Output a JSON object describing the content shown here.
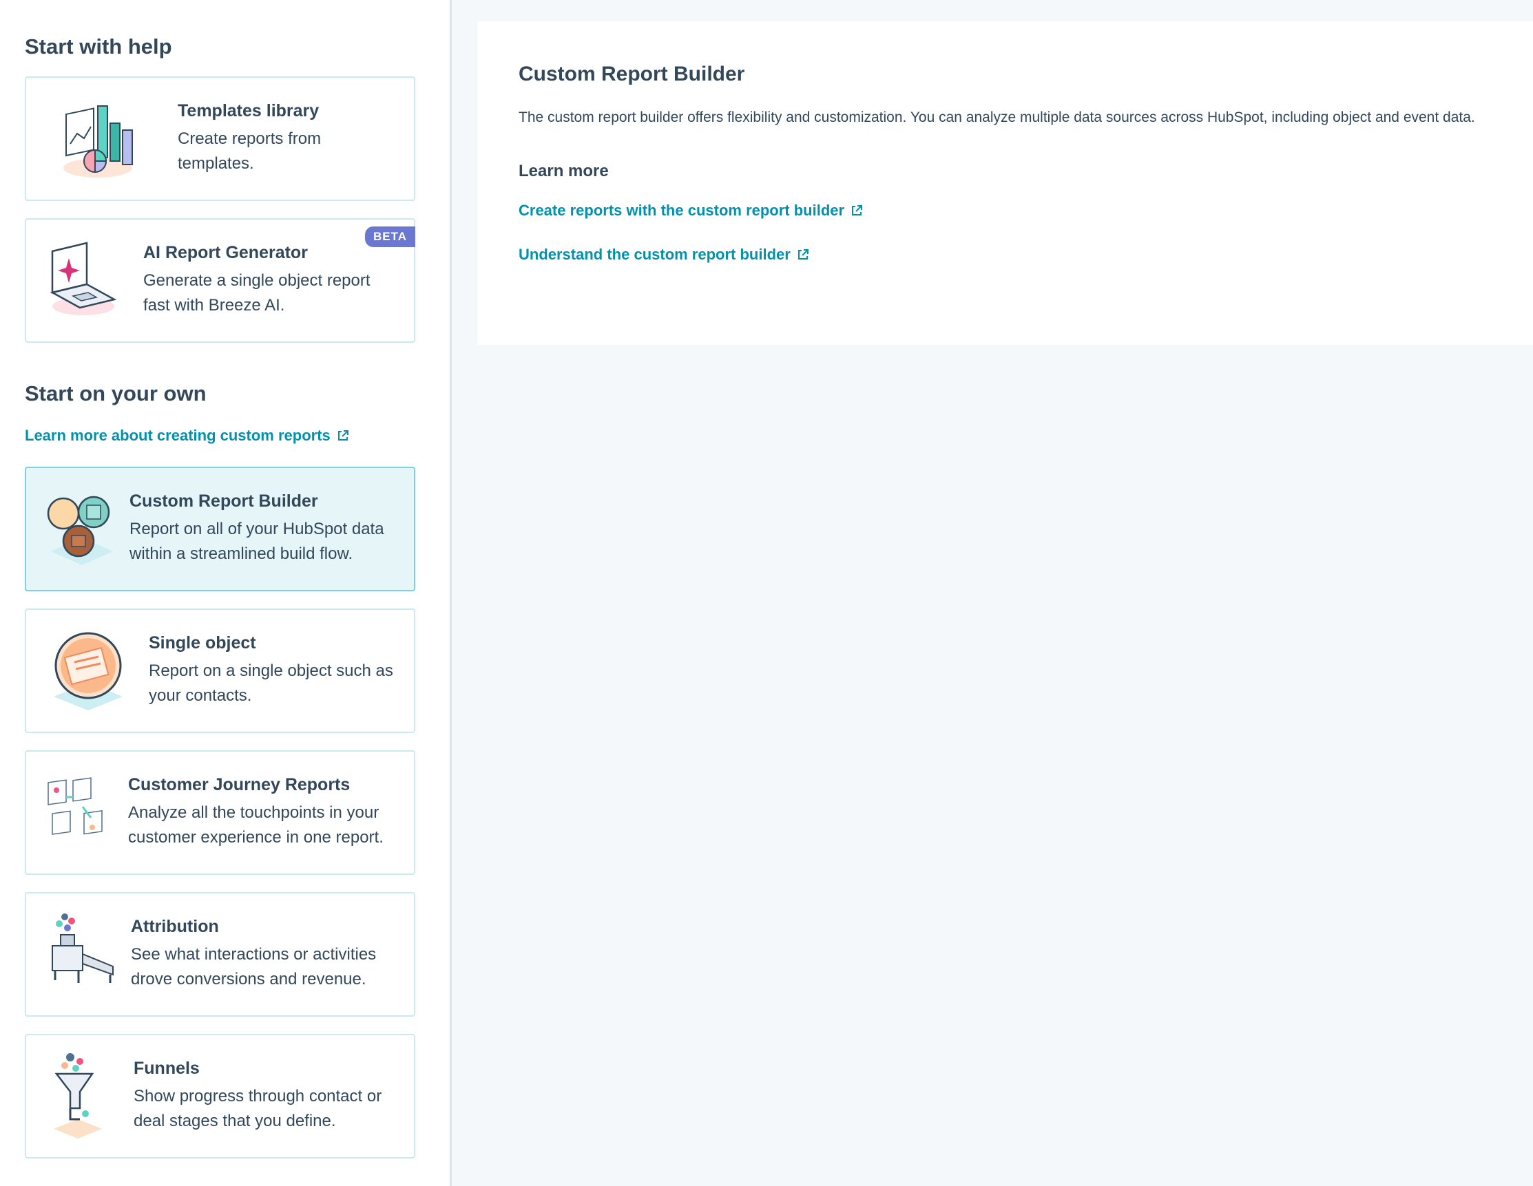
{
  "left": {
    "help_heading": "Start with help",
    "own_heading": "Start on your own",
    "learn_link": "Learn more about creating custom reports",
    "help_cards": [
      {
        "title": "Templates library",
        "desc": "Create reports from templates."
      },
      {
        "title": "AI Report Generator",
        "desc": "Generate a single object report fast with Breeze AI.",
        "badge": "BETA"
      }
    ],
    "own_cards": [
      {
        "title": "Custom Report Builder",
        "desc": "Report on all of your HubSpot data within a streamlined build flow."
      },
      {
        "title": "Single object",
        "desc": "Report on a single object such as your contacts."
      },
      {
        "title": "Customer Journey Reports",
        "desc": "Analyze all the touchpoints in your customer experience in one report."
      },
      {
        "title": "Attribution",
        "desc": "See what interactions or activities drove conversions and revenue."
      },
      {
        "title": "Funnels",
        "desc": "Show progress through contact or deal stages that you define."
      }
    ]
  },
  "detail": {
    "title": "Custom Report Builder",
    "description": "The custom report builder offers flexibility and customization. You can analyze multiple data sources across HubSpot, including object and event data.",
    "learn_more_heading": "Learn more",
    "links": [
      "Create reports with the custom report builder",
      "Understand the custom report builder"
    ]
  },
  "colors": {
    "accent_link": "#0091ae",
    "text": "#33475b",
    "selected_bg": "#e5f5f8",
    "beta": "#6a78d1"
  }
}
